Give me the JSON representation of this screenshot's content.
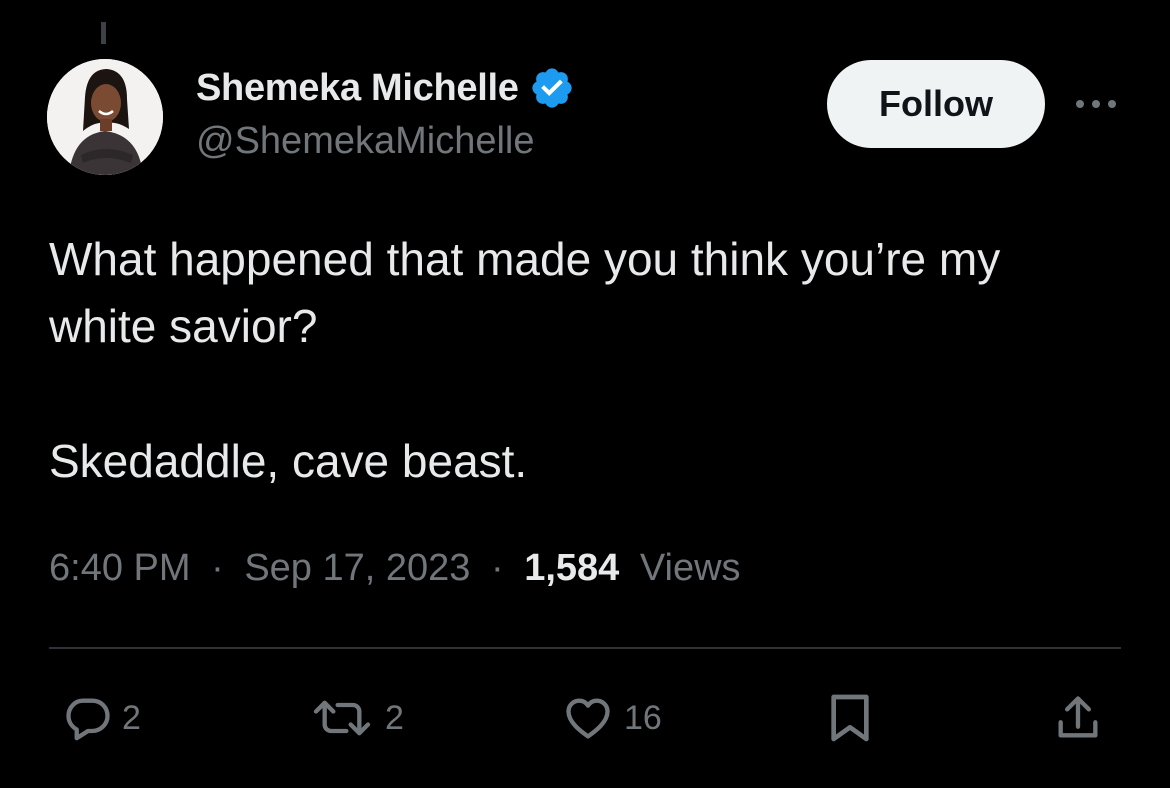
{
  "author": {
    "display_name": "Shemeka Michelle",
    "handle": "@ShemekaMichelle",
    "verified": true,
    "verified_color": "#1d9bf0"
  },
  "follow_button": {
    "label": "Follow"
  },
  "tweet": {
    "line1": "What happened that made you think you’re my",
    "line2": "white savior?",
    "line3": "Skedaddle, cave beast."
  },
  "meta": {
    "time": "6:40 PM",
    "separator": "·",
    "date": "Sep 17, 2023",
    "views_count": "1,584",
    "views_label": "Views"
  },
  "actions": {
    "reply_count": "2",
    "retweet_count": "2",
    "like_count": "16"
  },
  "icons": {
    "avatar": "profile-photo",
    "verified": "verified-badge-icon",
    "more": "more-horizontal-icon",
    "reply": "reply-bubble-icon",
    "retweet": "retweet-icon",
    "like": "heart-icon",
    "bookmark": "bookmark-icon",
    "share": "share-icon"
  },
  "colors": {
    "background": "#000000",
    "primary_text": "#e7e9ea",
    "secondary_text": "#71767b",
    "follow_bg": "#eff3f4",
    "follow_text": "#0f1419"
  }
}
